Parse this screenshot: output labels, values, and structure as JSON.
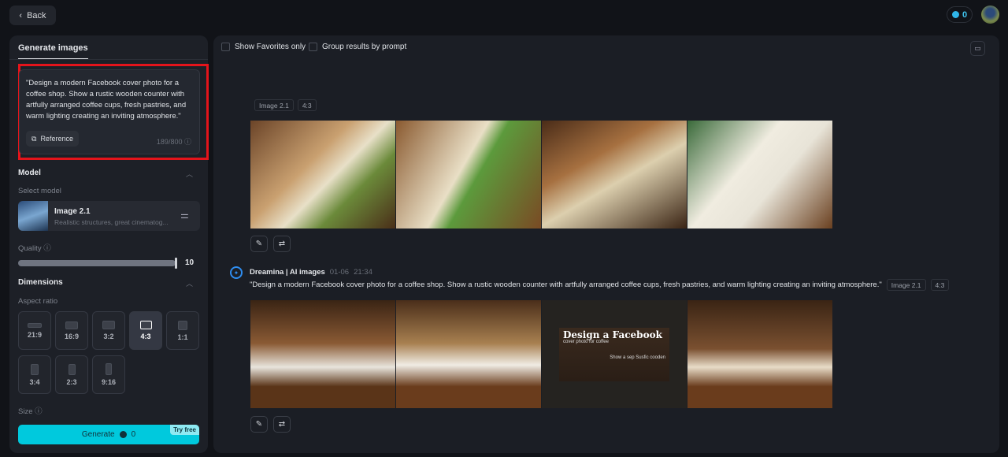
{
  "header": {
    "back_label": "Back",
    "credits": "0"
  },
  "sidebar": {
    "tab": "Generate images",
    "prompt": "\"Design a modern Facebook cover photo for a coffee shop. Show a rustic wooden counter with artfully arranged coffee cups, fresh pastries, and warm lighting creating an inviting atmosphere.\"",
    "reference_label": "Reference",
    "char_count": "189/800",
    "model_heading": "Model",
    "select_model_label": "Select model",
    "model_name": "Image 2.1",
    "model_desc": "Realistic structures, great cinematog...",
    "quality_label": "Quality",
    "quality_value": "10",
    "quality_fraction": 1.0,
    "dimensions_heading": "Dimensions",
    "aspect_ratio_label": "Aspect ratio",
    "aspect_ratios": [
      "21:9",
      "16:9",
      "3:2",
      "4:3",
      "1:1",
      "3:4",
      "2:3",
      "9:16"
    ],
    "selected_ratio": "4:3",
    "size_label": "Size",
    "generate_label": "Generate",
    "generate_cost": "0",
    "try_free": "Try free"
  },
  "main": {
    "show_favorites": "Show Favorites only",
    "group_by_prompt": "Group results by prompt",
    "group1": {
      "tags": [
        "Image 2.1",
        "4:3"
      ]
    },
    "group2": {
      "author": "Dreamina | AI images",
      "date": "01-06",
      "time": "21:34",
      "prompt": "\"Design a modern Facebook cover photo for a coffee shop. Show a rustic wooden counter with artfully arranged coffee cups, fresh pastries, and warm lighting creating an inviting atmosphere.\"",
      "tags": [
        "Image 2.1",
        "4:3"
      ],
      "image3_text": {
        "title": "Design a Facebook",
        "subtitle": "cover photo for coffee",
        "body": "Show a sep Susfic cooden"
      }
    }
  },
  "colors": {
    "accent": "#00c9dd",
    "highlight": "#e5141b"
  }
}
